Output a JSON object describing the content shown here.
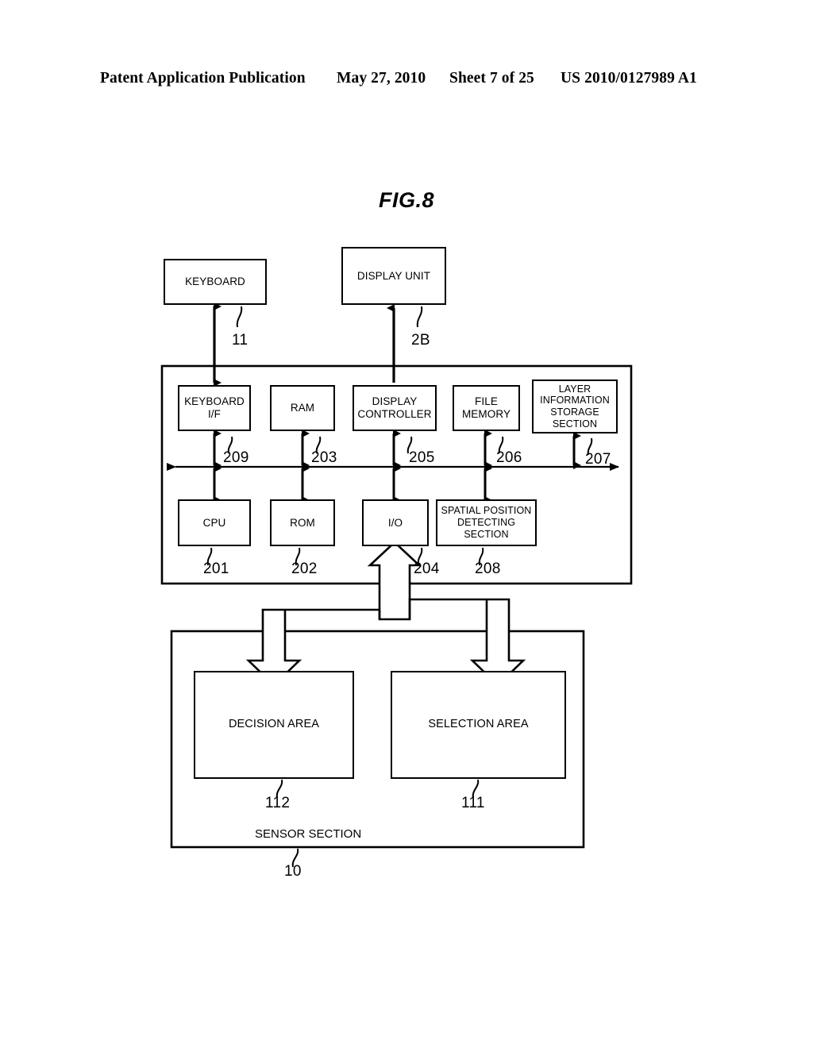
{
  "header": {
    "publication": "Patent Application Publication",
    "date": "May 27, 2010",
    "sheet": "Sheet 7 of 25",
    "number": "US 2010/0127989 A1"
  },
  "figure": {
    "title": "FIG.8"
  },
  "external_units": [
    {
      "id": "keyboard",
      "label": "KEYBOARD",
      "ref": "11"
    },
    {
      "id": "display_unit",
      "label": "DISPLAY UNIT",
      "ref": "2B"
    }
  ],
  "main_unit": {
    "top_row": [
      {
        "id": "keyboard_if",
        "label": "KEYBOARD\nI/F",
        "ref": "209"
      },
      {
        "id": "ram",
        "label": "RAM",
        "ref": "203"
      },
      {
        "id": "display_ctrl",
        "label": "DISPLAY\nCONTROLLER",
        "ref": "205"
      },
      {
        "id": "file_memory",
        "label": "FILE\nMEMORY",
        "ref": "206"
      },
      {
        "id": "layer_info",
        "label": "LAYER\nINFORMATION\nSTORAGE\nSECTION",
        "ref": "207"
      }
    ],
    "bottom_row": [
      {
        "id": "cpu",
        "label": "CPU",
        "ref": "201"
      },
      {
        "id": "rom",
        "label": "ROM",
        "ref": "202"
      },
      {
        "id": "io",
        "label": "I/O",
        "ref": "204"
      },
      {
        "id": "spatial_pos",
        "label": "SPATIAL POSITION\nDETECTING\nSECTION",
        "ref": "208"
      }
    ]
  },
  "sensor_section": {
    "label": "SENSOR SECTION",
    "ref": "10",
    "areas": [
      {
        "id": "decision_area",
        "label": "DECISION AREA",
        "ref": "112"
      },
      {
        "id": "selection_area",
        "label": "SELECTION AREA",
        "ref": "111"
      }
    ]
  },
  "colors": {
    "ink": "#000000",
    "paper": "#ffffff"
  }
}
